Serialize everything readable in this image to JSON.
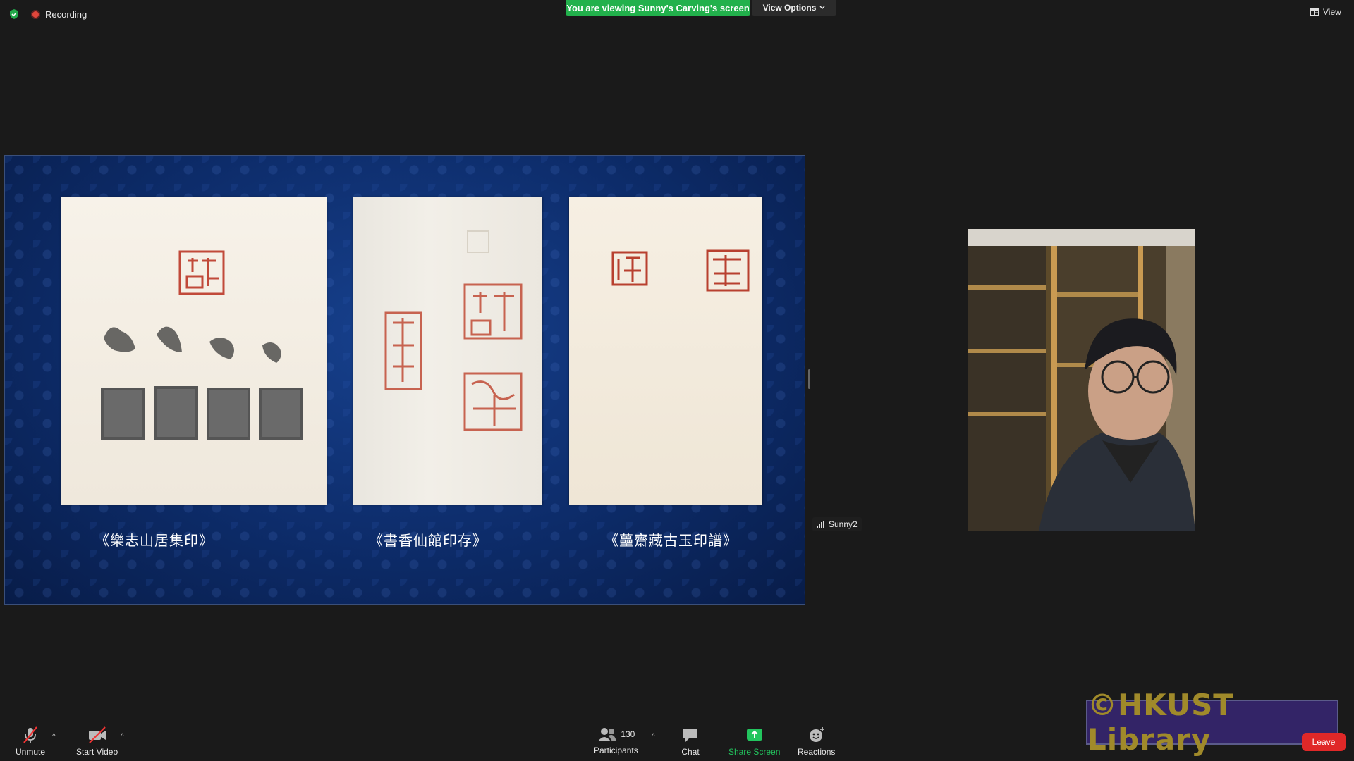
{
  "topbar": {
    "recording_label": "Recording",
    "viewing_banner": "You are viewing Sunny's Carving's screen",
    "view_options_label": "View Options",
    "view_label": "View"
  },
  "shared_screen": {
    "captions": [
      "《樂志山居集印》",
      "《書香仙館印存》",
      "《蘲齋藏古玉印譜》"
    ],
    "background_color": "#0d2c6a"
  },
  "participant": {
    "name": "Sunny2"
  },
  "toolbar": {
    "unmute_label": "Unmute",
    "start_video_label": "Start Video",
    "participants_label": "Participants",
    "participants_count": "130",
    "chat_label": "Chat",
    "share_screen_label": "Share Screen",
    "reactions_label": "Reactions",
    "leave_label": "Leave",
    "share_color": "#22c55e",
    "leave_color": "#e02828"
  },
  "watermark": {
    "text": "©HKUST Library"
  }
}
